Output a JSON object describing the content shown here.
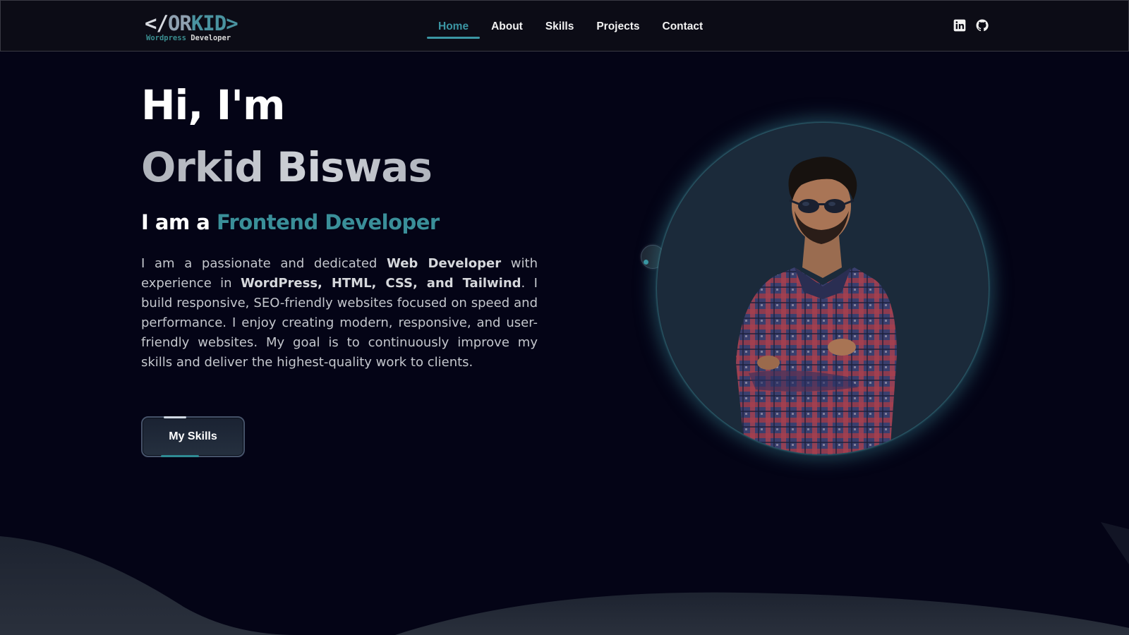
{
  "logo": {
    "part1": "</",
    "part2": "OR",
    "part3": "KID>",
    "sub1": "Wordpress",
    "sub2": "Developer"
  },
  "nav": {
    "items": [
      {
        "label": "Home",
        "active": true
      },
      {
        "label": "About",
        "active": false
      },
      {
        "label": "Skills",
        "active": false
      },
      {
        "label": "Projects",
        "active": false
      },
      {
        "label": "Contact",
        "active": false
      }
    ],
    "social": [
      {
        "icon": "linkedin-icon"
      },
      {
        "icon": "github-icon"
      }
    ]
  },
  "hero": {
    "greeting": "Hi, I'm",
    "name": "Orkid Biswas",
    "role_prefix": "I am a",
    "role_title": "Frontend Developer",
    "bio": {
      "t1": "I am a passionate and dedicated ",
      "b1": "Web Developer",
      "t2": " with experience in ",
      "b2": "WordPress, HTML, CSS, and Tailwind",
      "t3": ". I build responsive, SEO-friendly websites focused on speed and performance. I enjoy creating modern, responsive, and user-friendly websites. My goal is to continuously improve my skills and deliver the highest-quality work to clients."
    },
    "button_label": "My Skills"
  },
  "colors": {
    "background": "#040416",
    "accent": "#3b96a4",
    "navbar": "#0c0c16",
    "portrait_circle": "#1b2a3a"
  }
}
